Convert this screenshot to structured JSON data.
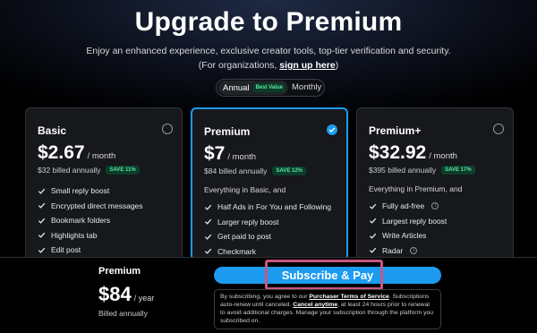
{
  "header": {
    "title": "Upgrade to Premium",
    "subtitle": "Enjoy an enhanced experience, exclusive creator tools, top-tier verification and security.",
    "org_prefix": "(For organizations, ",
    "org_link": "sign up here",
    "org_suffix": ")"
  },
  "billing_toggle": {
    "annual": "Annual",
    "best_value": "Best Value",
    "monthly": "Monthly",
    "selected": "Annual"
  },
  "plans": [
    {
      "name": "Basic",
      "price": "$2.67",
      "period": "/ month",
      "billed": "$32 billed annually",
      "save": "SAVE 11%",
      "selected": false,
      "intro": "",
      "features": [
        "Small reply boost",
        "Encrypted direct messages",
        "Bookmark folders",
        "Highlights tab",
        "Edit post"
      ]
    },
    {
      "name": "Premium",
      "price": "$7",
      "period": "/ month",
      "billed": "$84 billed annually",
      "save": "SAVE 12%",
      "selected": true,
      "intro": "Everything in Basic, and",
      "features": [
        "Half Ads in For You and Following",
        "Larger reply boost",
        "Get paid to post",
        "Checkmark"
      ]
    },
    {
      "name": "Premium+",
      "price": "$32.92",
      "period": "/ month",
      "billed": "$395 billed annually",
      "save": "SAVE 17%",
      "selected": false,
      "intro": "Everything in Premium, and",
      "features": [
        "Fully ad-free",
        "Largest reply boost",
        "Write Articles",
        "Radar"
      ]
    }
  ],
  "summary": {
    "name": "Premium",
    "price": "$84",
    "period": "/ year",
    "billed": "Billed annually"
  },
  "subscribe_label": "Subscribe & Pay",
  "terms": {
    "t1": "By subscribing, you agree to our ",
    "link1": "Purchaser Terms of Service",
    "t2": ". Subscriptions auto-renew until canceled. ",
    "link2": "Cancel anytime",
    "t3": ", at least 24 hours prior to renewal to avoid additional charges. Manage your subscription through the platform you subscribed on."
  },
  "colors": {
    "accent": "#1d9bf0",
    "save_bg": "#0b3d2a",
    "save_text": "#5fe3a1",
    "highlight": "#c8567f"
  }
}
